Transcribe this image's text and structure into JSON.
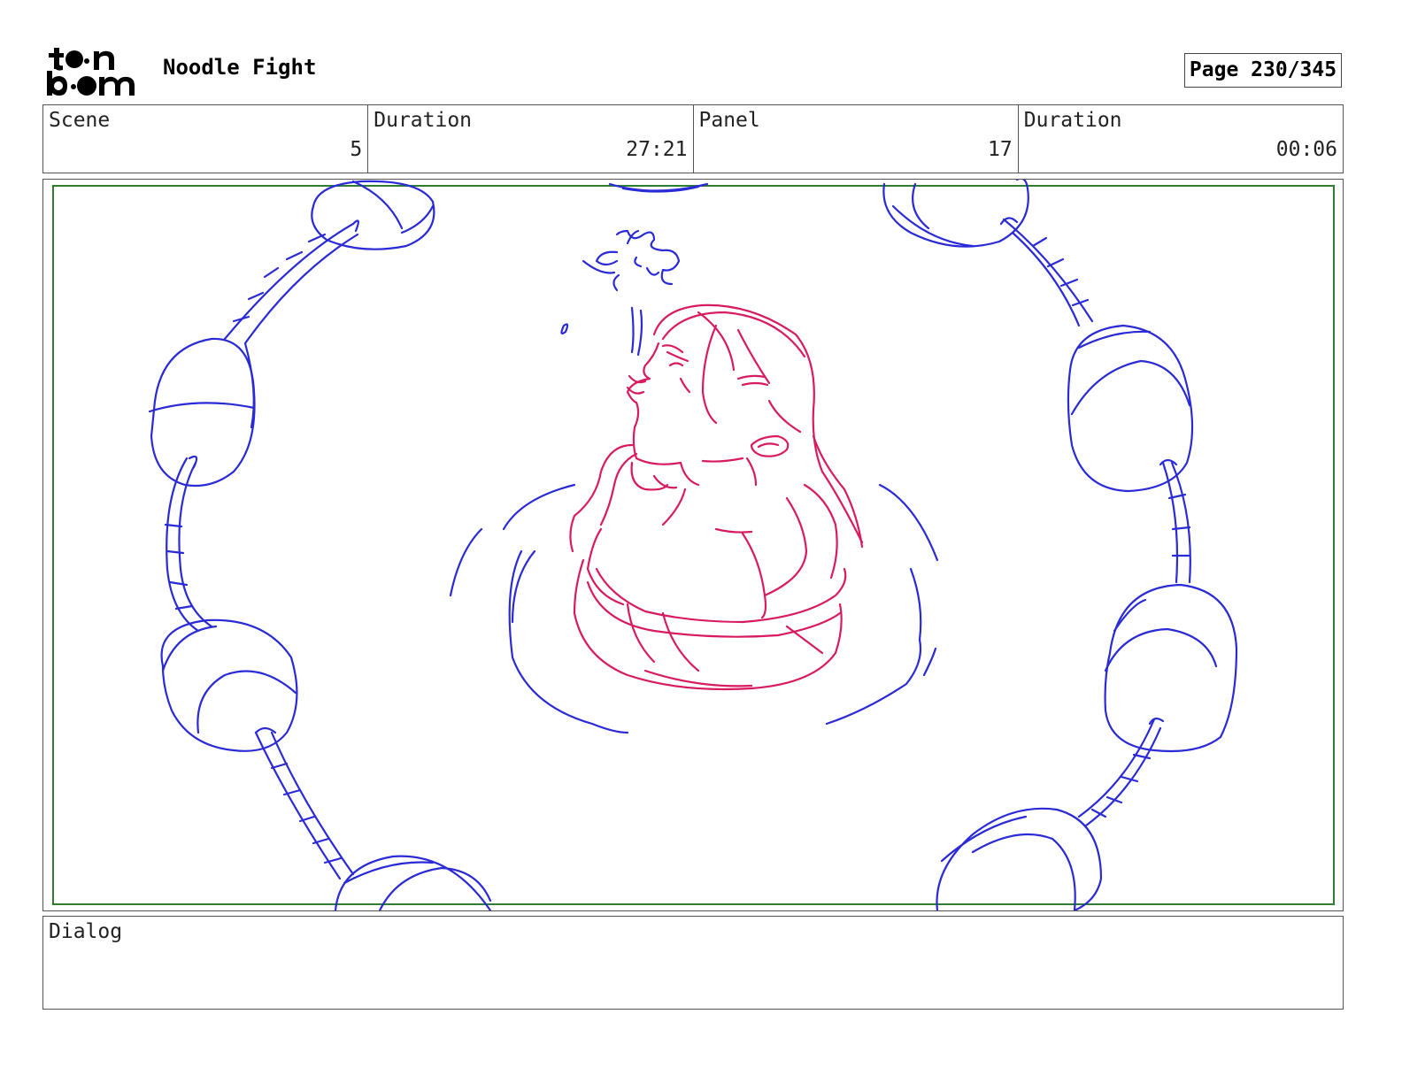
{
  "header": {
    "logo_text": "toon boom",
    "project_title": "Noodle Fight",
    "page_indicator": "Page 230/345"
  },
  "info_fields": [
    {
      "label": "Scene",
      "value": "5"
    },
    {
      "label": "Duration",
      "value": "27:21"
    },
    {
      "label": "Panel",
      "value": "17"
    },
    {
      "label": "Duration",
      "value": "00:06"
    }
  ],
  "panel": {
    "safe_frame_color": "#2e7d32",
    "background_sketch_color": "#2a2ad6",
    "character_sketch_color": "#d81b60"
  },
  "dialog": {
    "label": "Dialog",
    "text": ""
  }
}
